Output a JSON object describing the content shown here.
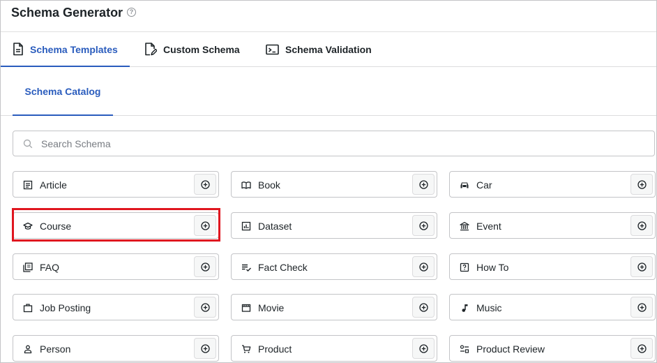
{
  "header": {
    "title": "Schema Generator",
    "help_icon": "help-circle-icon"
  },
  "main_tabs": [
    {
      "label": "Schema Templates",
      "icon": "document-icon",
      "active": true
    },
    {
      "label": "Custom Schema",
      "icon": "edit-document-icon",
      "active": false
    },
    {
      "label": "Schema Validation",
      "icon": "terminal-icon",
      "active": false
    }
  ],
  "sub_tabs": [
    {
      "label": "Schema Catalog",
      "active": true
    }
  ],
  "search": {
    "placeholder": "Search Schema",
    "value": ""
  },
  "colors": {
    "accent": "#2a5cbd",
    "highlight": "#e0161f"
  },
  "catalog": [
    {
      "label": "Article",
      "icon": "article-icon"
    },
    {
      "label": "Book",
      "icon": "book-icon"
    },
    {
      "label": "Car",
      "icon": "car-icon"
    },
    {
      "label": "Course",
      "icon": "graduation-cap-icon",
      "highlighted": true
    },
    {
      "label": "Dataset",
      "icon": "dataset-icon"
    },
    {
      "label": "Event",
      "icon": "event-building-icon"
    },
    {
      "label": "FAQ",
      "icon": "faq-icon"
    },
    {
      "label": "Fact Check",
      "icon": "fact-check-icon"
    },
    {
      "label": "How To",
      "icon": "how-to-icon"
    },
    {
      "label": "Job Posting",
      "icon": "briefcase-icon"
    },
    {
      "label": "Movie",
      "icon": "movie-icon"
    },
    {
      "label": "Music",
      "icon": "music-note-icon"
    },
    {
      "label": "Person",
      "icon": "person-icon"
    },
    {
      "label": "Product",
      "icon": "cart-icon"
    },
    {
      "label": "Product Review",
      "icon": "review-icon"
    }
  ]
}
